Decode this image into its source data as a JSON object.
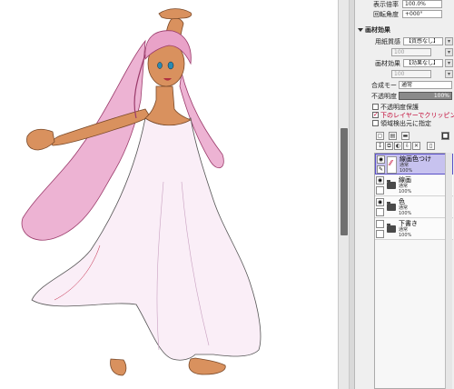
{
  "navigator": {
    "zoom_label": "表示倍率",
    "zoom_value": "100.0%",
    "rotate_label": "回転角度",
    "rotate_value": "+000°"
  },
  "paper_effect": {
    "section_label": "画材効果",
    "texture_label": "用紙質感",
    "texture_value": "【質感なし】",
    "texture_strength": "100",
    "effect_label": "画材効果",
    "effect_value": "【効果なし】",
    "effect_strength": "100"
  },
  "layer_props": {
    "blend_mode_label": "合成モード",
    "blend_mode_value": "通常",
    "opacity_label": "不透明度",
    "opacity_value": "100%",
    "preserve_opacity_label": "不透明度保護",
    "clipping_label": "下のレイヤーでクリッピング",
    "selection_source_label": "領域検出元に指定"
  },
  "layers": [
    {
      "name": "線画色つけ",
      "mode": "通常",
      "opacity": "100%",
      "selected": true,
      "is_folder": false
    },
    {
      "name": "線画",
      "mode": "通常",
      "opacity": "100%",
      "selected": false,
      "is_folder": true
    },
    {
      "name": "色",
      "mode": "通常",
      "opacity": "100%",
      "selected": false,
      "is_folder": true
    },
    {
      "name": "下書き",
      "mode": "通常",
      "opacity": "100%",
      "selected": false,
      "is_folder": true
    }
  ],
  "colors": {
    "selected_layer": "#c7c2ef",
    "skin": "#d9915e",
    "hair": "#e9a2c8",
    "dress": "#f9eef6"
  },
  "icons": {
    "eye": "eye-icon",
    "lock": "lock-icon",
    "folder": "folder-icon"
  }
}
